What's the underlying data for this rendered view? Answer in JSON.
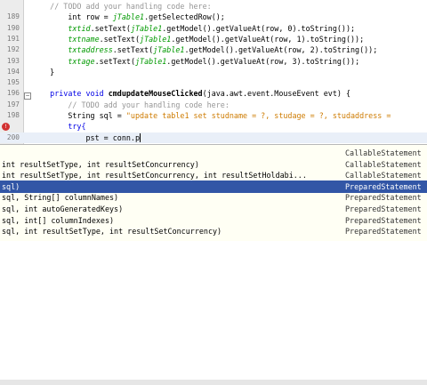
{
  "editor": {
    "lines": [
      {
        "num": "",
        "segments": [
          {
            "t": "    // TODO add your handling code here:",
            "c": "cmt"
          }
        ]
      },
      {
        "num": "189",
        "segments": [
          {
            "t": "        int row = ",
            "c": ""
          },
          {
            "t": "jTable1",
            "c": "fieldi"
          },
          {
            "t": ".getSelectedRow();",
            "c": ""
          }
        ]
      },
      {
        "num": "190",
        "segments": [
          {
            "t": "        ",
            "c": ""
          },
          {
            "t": "txtid",
            "c": "fieldi"
          },
          {
            "t": ".setText(",
            "c": ""
          },
          {
            "t": "jTable1",
            "c": "fieldi"
          },
          {
            "t": ".getModel().getValueAt(row, 0).toString());",
            "c": ""
          }
        ]
      },
      {
        "num": "191",
        "segments": [
          {
            "t": "        ",
            "c": ""
          },
          {
            "t": "txtname",
            "c": "fieldi"
          },
          {
            "t": ".setText(",
            "c": ""
          },
          {
            "t": "jTable1",
            "c": "fieldi"
          },
          {
            "t": ".getModel().getValueAt(row, 1).toString());",
            "c": ""
          }
        ]
      },
      {
        "num": "192",
        "segments": [
          {
            "t": "        ",
            "c": ""
          },
          {
            "t": "txtaddress",
            "c": "fieldi"
          },
          {
            "t": ".setText(",
            "c": ""
          },
          {
            "t": "jTable1",
            "c": "fieldi"
          },
          {
            "t": ".getModel().getValueAt(row, 2).toString());",
            "c": ""
          }
        ]
      },
      {
        "num": "193",
        "segments": [
          {
            "t": "        ",
            "c": ""
          },
          {
            "t": "txtage",
            "c": "fieldi"
          },
          {
            "t": ".setText(",
            "c": ""
          },
          {
            "t": "jTable1",
            "c": "fieldi"
          },
          {
            "t": ".getModel().getValueAt(row, 3).toString());",
            "c": ""
          }
        ]
      },
      {
        "num": "194",
        "segments": [
          {
            "t": "    }",
            "c": ""
          }
        ]
      },
      {
        "num": "195",
        "segments": [
          {
            "t": "",
            "c": ""
          }
        ]
      },
      {
        "num": "196",
        "segments": [
          {
            "t": "    private void ",
            "c": "kw"
          },
          {
            "t": "cmdupdateMouseClicked",
            "c": "bold"
          },
          {
            "t": "(java.awt.event.MouseEvent evt) {",
            "c": ""
          }
        ]
      },
      {
        "num": "197",
        "segments": [
          {
            "t": "        // TODO add your handling code here:",
            "c": "cmt"
          }
        ]
      },
      {
        "num": "198",
        "segments": [
          {
            "t": "        String sql = ",
            "c": ""
          },
          {
            "t": "\"update table1 set studname = ?, studage = ?, studaddress = ",
            "c": "str"
          }
        ]
      },
      {
        "num": "",
        "segments": [
          {
            "t": "        try{",
            "c": "kw"
          }
        ]
      },
      {
        "num": "200",
        "segments": [
          {
            "t": "            pst = conn.p",
            "c": ""
          }
        ]
      }
    ]
  },
  "completion": {
    "items": [
      {
        "sig": "",
        "ret": "CallableStatement"
      },
      {
        "sig": "int resultSetType, int resultSetConcurrency)",
        "ret": "CallableStatement"
      },
      {
        "sig": "int resultSetType, int resultSetConcurrency, int resultSetHoldabi...",
        "ret": "CallableStatement"
      },
      {
        "sig": "sql)",
        "ret": "PreparedStatement"
      },
      {
        "sig": "sql, String[] columnNames)",
        "ret": "PreparedStatement"
      },
      {
        "sig": "sql, int autoGeneratedKeys)",
        "ret": "PreparedStatement"
      },
      {
        "sig": "sql, int[] columnIndexes)",
        "ret": "PreparedStatement"
      },
      {
        "sig": "sql, int resultSetType, int resultSetConcurrency)",
        "ret": "PreparedStatement"
      }
    ],
    "selected_index": 3
  },
  "colors": {
    "selection": "#3256a6",
    "popup_bg": "#fffff4",
    "keyword": "#0000e6",
    "string": "#ce7b00",
    "comment": "#969696"
  }
}
